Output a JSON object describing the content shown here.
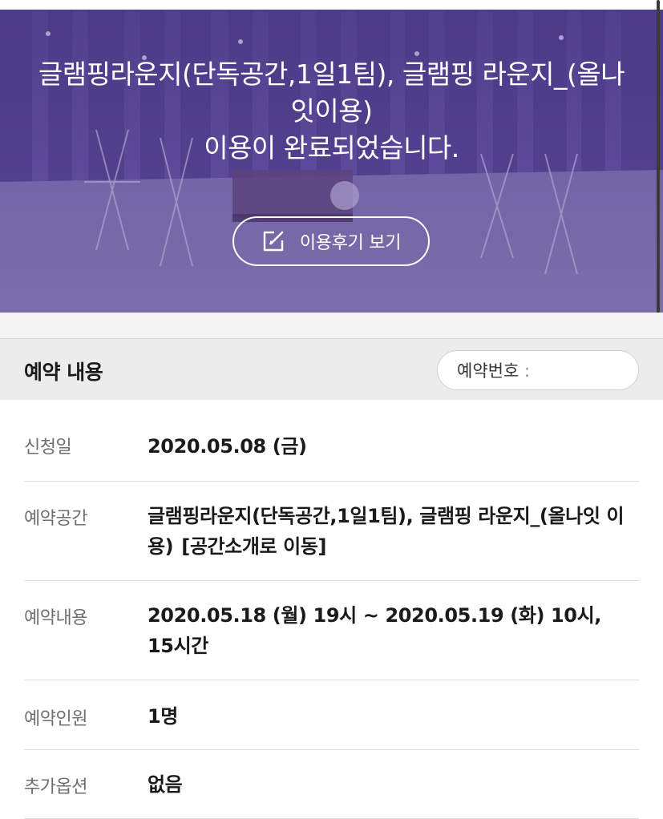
{
  "hero": {
    "title_line1": "글램핑라운지(단독공간,1일1팀), 글램핑 라운지_(올나",
    "title_line2": "잇이용)",
    "title_line3": "이용이 완료되었습니다.",
    "review_button_label": "이용후기 보기",
    "review_button_icon": "edit-icon"
  },
  "section": {
    "title": "예약 내용",
    "reservation_number_label": "예약번호 :"
  },
  "details": {
    "applied_date": {
      "label": "신청일",
      "value": "2020.05.08 (금)"
    },
    "space": {
      "label": "예약공간",
      "value": "글램핑라운지(단독공간,1일1팀), 글램핑 라운지_(올나잇 이용)",
      "link_label": "[공간소개로 이동]"
    },
    "content": {
      "label": "예약내용",
      "value": "2020.05.18 (월) 19시 ~ 2020.05.19 (화) 10시, 15시간"
    },
    "people": {
      "label": "예약인원",
      "value": "1명"
    },
    "options": {
      "label": "추가옵션",
      "value": "없음"
    }
  },
  "colors": {
    "hero_overlay": "#6a55a4",
    "header_bg": "#ececec",
    "text_primary": "#1a1a1a",
    "text_label": "#6f6f6f"
  }
}
